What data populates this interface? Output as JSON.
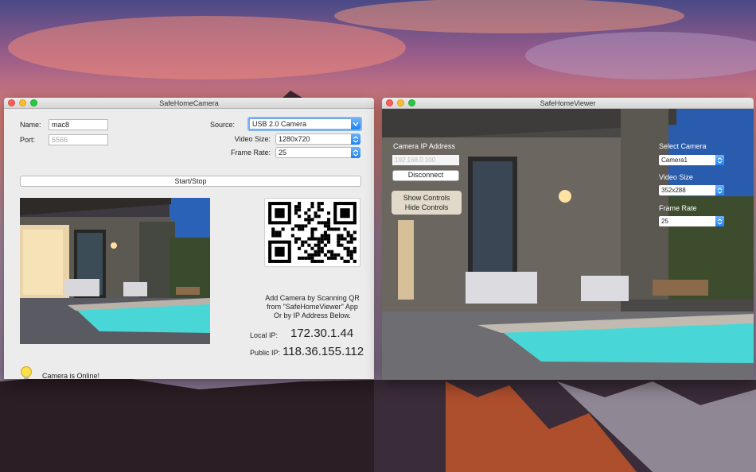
{
  "camera_window": {
    "title": "SafeHomeCamera",
    "name_label": "Name:",
    "name_value": "mac8",
    "port_label": "Port:",
    "port_value": "5566",
    "source_label": "Source:",
    "source_value": "USB 2.0 Camera",
    "video_size_label": "Video Size:",
    "video_size_value": "1280x720",
    "frame_rate_label": "Frame Rate:",
    "frame_rate_value": "25",
    "start_stop_label": "Start/Stop",
    "qr_caption_1": "Add Camera by Scanning QR",
    "qr_caption_2": "from \"SafeHomeViewer\" App",
    "qr_caption_3": "Or by IP Address Below.",
    "local_ip_label": "Local IP:",
    "local_ip_value": "172.30.1.44",
    "public_ip_label": "Public IP:",
    "public_ip_value": "118.36.155.112",
    "status_text": "Camera is Online!"
  },
  "viewer_window": {
    "title": "SafeHomeViewer",
    "camera_ip_label": "Camera IP Address",
    "camera_ip_placeholder": "192.168.0.100",
    "disconnect_label": "Disconnect",
    "show_controls_label": "Show Controls",
    "hide_controls_label": "Hide Controls",
    "select_camera_label": "Select Camera",
    "select_camera_value": "Camera1",
    "video_size_label": "Video Size",
    "video_size_value": "352x288",
    "frame_rate_label": "Frame Rate",
    "frame_rate_value": "25"
  },
  "colors": {
    "accent": "#1a82fb",
    "pool": "#49d6d6"
  },
  "icons": {
    "bulb": "lightbulb-icon",
    "dropdown": "chevron-updown-icon"
  }
}
